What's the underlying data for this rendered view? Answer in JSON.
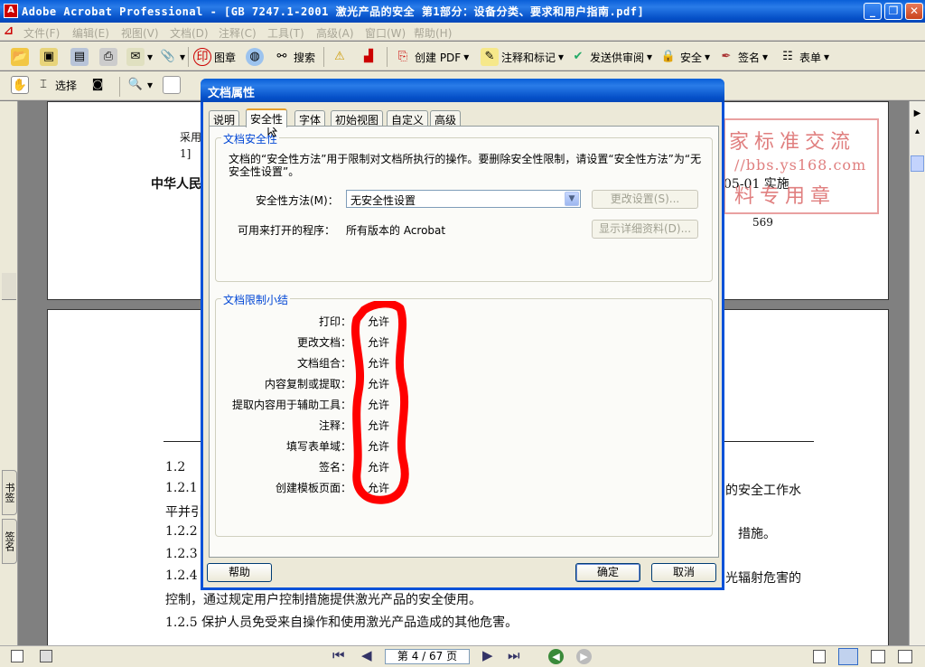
{
  "window": {
    "title": "Adobe Acrobat Professional - [GB 7247.1-2001 激光产品的安全 第1部分：设备分类、要求和用户指南.pdf]",
    "minimize": "_",
    "restore": "❐",
    "close": "✕"
  },
  "menubar": {
    "items": [
      "文件(F)",
      "编辑(E)",
      "视图(V)",
      "文档(D)",
      "注释(C)",
      "工具(T)",
      "高级(A)",
      "窗口(W)",
      "帮助(H)"
    ]
  },
  "toolbar1": {
    "stamp_label": "图章",
    "search_label": "搜索",
    "create_pdf_label": "创建 PDF",
    "comment_label": "注释和标记",
    "review_label": "发送供审阅",
    "security_label": "安全",
    "sign_label": "签名",
    "forms_label": "表单"
  },
  "toolbar2": {
    "select_label": "选择"
  },
  "document": {
    "page1_text": {
      "t1": "采用",
      "t2": "1]",
      "t3": "中华人民",
      "t4": "05-01 实施",
      "t5": "569",
      "stamp1": "家标准交流",
      "stamp2": "//bbs.ys168.com",
      "stamp3": "料专用章"
    },
    "page2_lines": {
      "l1": "1.2",
      "l2": "1.2.1",
      "l2r": "的安全工作水",
      "l3": "平并引",
      "l4": "1.2.2",
      "l4r": "措施。",
      "l5": "1.2.3",
      "l6": "1.2.4",
      "l6r": "光辐射危害的",
      "l7": "控制，通过规定用户控制措施提供激光产品的安全使用。",
      "l8": "1.2.5   保护人员免受来自操作和使用激光产品造成的其他危害。"
    }
  },
  "left_tabs": {
    "bookmarks": "书签",
    "signatures": "签名"
  },
  "statusbar": {
    "page_display": "第 4 / 67 页"
  },
  "dialog": {
    "title": "文档属性",
    "tabs": [
      "说明",
      "安全性",
      "字体",
      "初始视图",
      "自定义",
      "高级"
    ],
    "active_tab": "安全性",
    "security_group": {
      "title": "文档安全性",
      "description": "文档的“安全性方法”用于限制对文档所执行的操作。要删除安全性限制，请设置“安全性方法”为“无安全性设置”。",
      "method_label": "安全性方法(M)：",
      "method_value": "无安全性设置",
      "change_button": "更改设置(S)...",
      "opened_by_label": "可用来打开的程序：",
      "opened_by_value": "所有版本的 Acrobat",
      "details_button": "显示详细资料(D)..."
    },
    "summary_group": {
      "title": "文档限制小结",
      "rows": [
        {
          "label": "打印：",
          "value": "允许"
        },
        {
          "label": "更改文档：",
          "value": "允许"
        },
        {
          "label": "文档组合：",
          "value": "允许"
        },
        {
          "label": "内容复制或提取：",
          "value": "允许"
        },
        {
          "label": "提取内容用于辅助工具：",
          "value": "允许"
        },
        {
          "label": "注释：",
          "value": "允许"
        },
        {
          "label": "填写表单域：",
          "value": "允许"
        },
        {
          "label": "签名：",
          "value": "允许"
        },
        {
          "label": "创建模板页面：",
          "value": "允许"
        }
      ]
    },
    "help_button": "帮助",
    "ok_button": "确定",
    "cancel_button": "取消"
  },
  "colors": {
    "accent_blue": "#0a52d8",
    "annotation_red": "#ff0000",
    "group_title": "#0046d5"
  }
}
